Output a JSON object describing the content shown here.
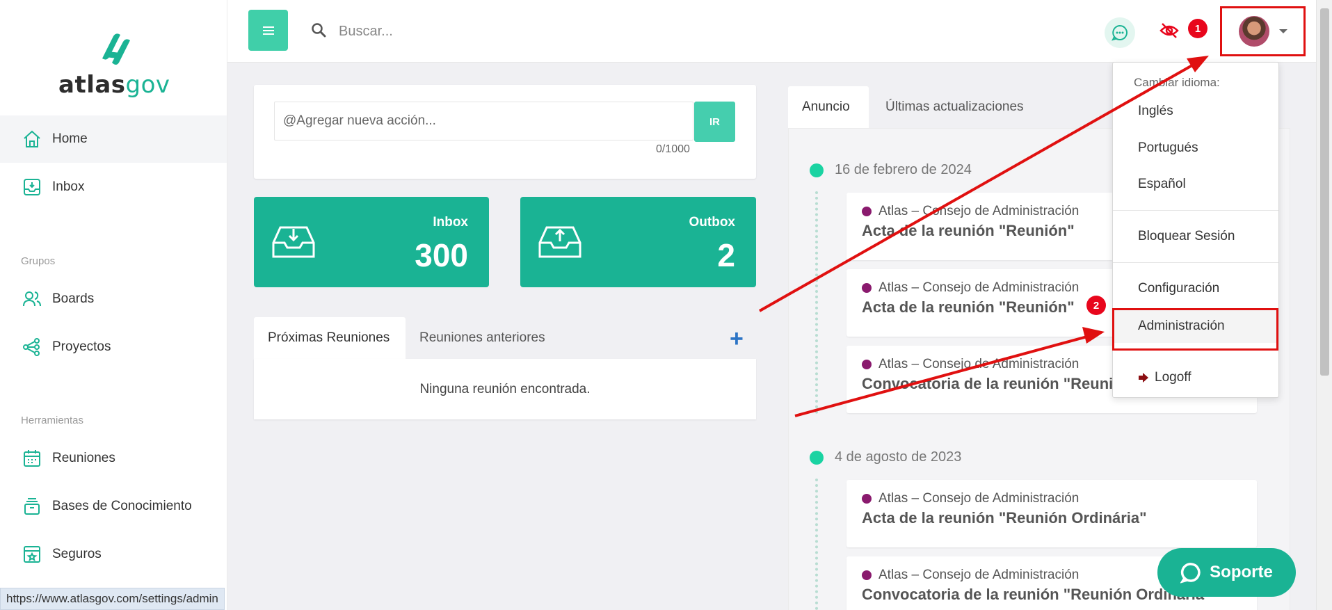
{
  "logo": {
    "text_a": "atlas",
    "text_b": "gov"
  },
  "sidebar": {
    "items": [
      {
        "label": "Home",
        "icon": "home-icon"
      },
      {
        "label": "Inbox",
        "icon": "inbox-icon"
      }
    ],
    "groups_label": "Grupos",
    "groups": [
      {
        "label": "Boards",
        "icon": "users-icon"
      },
      {
        "label": "Proyectos",
        "icon": "share-nodes-icon"
      }
    ],
    "tools_label": "Herramientas",
    "tools": [
      {
        "label": "Reuniones",
        "icon": "calendar-icon"
      },
      {
        "label": "Bases de Conocimiento",
        "icon": "archive-icon"
      },
      {
        "label": "Seguros",
        "icon": "vault-icon"
      }
    ]
  },
  "topbar": {
    "search_placeholder": "Buscar...",
    "badge1": "1",
    "badge2": "2"
  },
  "action": {
    "placeholder": "@Agregar nueva acción...",
    "button": "IR",
    "counter": "0/1000"
  },
  "stats": {
    "inbox": {
      "label": "Inbox",
      "value": "300"
    },
    "outbox": {
      "label": "Outbox",
      "value": "2"
    }
  },
  "meetings": {
    "tab_next": "Próximas Reuniones",
    "tab_prev": "Reuniones anteriores",
    "add": "+",
    "empty": "Ninguna reunión encontrada."
  },
  "news": {
    "tab_announcement": "Anuncio",
    "tab_updates": "Últimas actualizaciones",
    "groups": [
      {
        "date": "16 de febrero de 2024",
        "items": [
          {
            "org": "Atlas – Consejo de Administración",
            "title": "Acta de la reunión \"Reunión\""
          },
          {
            "org": "Atlas – Consejo de Administración",
            "title": "Acta de la reunión \"Reunión\""
          },
          {
            "org": "Atlas – Consejo de Administración",
            "title": "Convocatoria de la reunión \"Reunión\""
          }
        ]
      },
      {
        "date": "4 de agosto de 2023",
        "items": [
          {
            "org": "Atlas – Consejo de Administración",
            "title": "Acta de la reunión \"Reunión Ordinária\""
          },
          {
            "org": "Atlas – Consejo de Administración",
            "title": "Convocatoria de la reunión \"Reunión Ordinária\""
          }
        ]
      }
    ]
  },
  "dropdown": {
    "header": "Cambiar idioma:",
    "languages": [
      "Inglés",
      "Portugués",
      "Español"
    ],
    "lock": "Bloquear Sesión",
    "config": "Configuración",
    "admin": "Administración",
    "logoff": "Logoff"
  },
  "status_url": "https://www.atlasgov.com/settings/admin",
  "support": "Soporte",
  "colors": {
    "accent": "#1ab394",
    "annotation": "#e01010"
  }
}
